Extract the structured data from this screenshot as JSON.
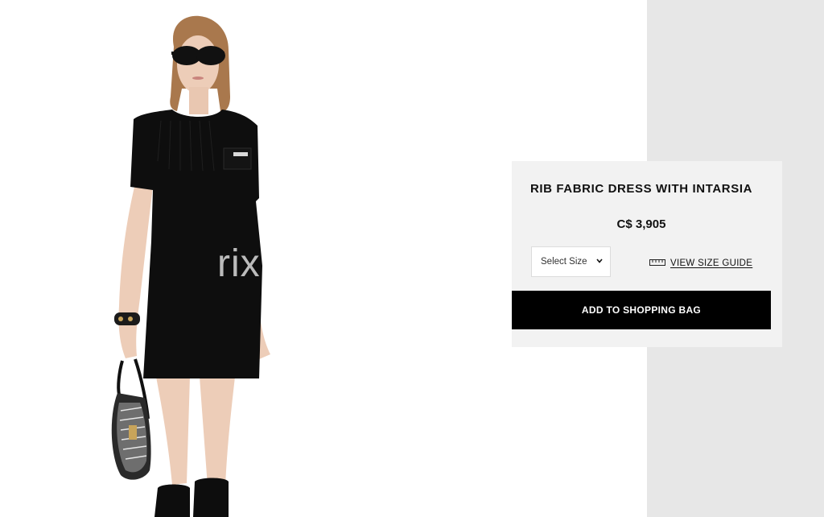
{
  "product": {
    "title": "RIB FABRIC DRESS WITH INTARSIA",
    "price": "C$ 3,905",
    "size_select_placeholder": "Select Size",
    "size_guide_label": "VIEW SIZE GUIDE",
    "add_to_bag_label": "ADD TO SHOPPING BAG"
  },
  "watermark": "rix",
  "icons": {
    "size_select": "chevron-down-icon",
    "size_guide": "ruler-icon"
  },
  "colors": {
    "button_bg": "#000000",
    "button_text": "#ffffff",
    "panel_bg": "#f2f2f2",
    "side_bg": "#e7e7e7"
  }
}
